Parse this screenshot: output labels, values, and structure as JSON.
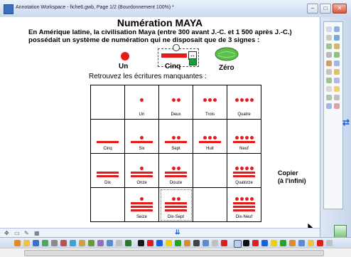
{
  "window": {
    "title": "Annotation Workspace - fiche6.gwb, Page 1/2  (Bourdonnement 100%) *"
  },
  "page": {
    "title": "Numération MAYA",
    "intro": "En Amérique latine, la civilisation Maya (entre 300 avant J.-C. et 1 500 après J.-C.) possédait un système de numération qui ne disposait que de 3 signes :",
    "signs": [
      "Un",
      "Cinq",
      "Zéro"
    ],
    "subtitle": "Retrouvez les écritures manquantes :",
    "copy_note": [
      "Copier",
      "(à l'infini)"
    ]
  },
  "grid": {
    "rows": [
      [
        {
          "label": "",
          "value": null
        },
        {
          "label": "Un",
          "value": 1
        },
        {
          "label": "Deux",
          "value": 2
        },
        {
          "label": "Trois",
          "value": 3
        },
        {
          "label": "Quatre",
          "value": 4
        }
      ],
      [
        {
          "label": "Cinq",
          "value": 5
        },
        {
          "label": "Six",
          "value": 6
        },
        {
          "label": "Sept",
          "value": 7
        },
        {
          "label": "Huit",
          "value": 8
        },
        {
          "label": "Neuf",
          "value": 9
        }
      ],
      [
        {
          "label": "Dix",
          "value": 10
        },
        {
          "label": "Onze",
          "value": 11
        },
        {
          "label": "Douze",
          "value": 12
        },
        {
          "label": "",
          "value": null
        },
        {
          "label": "Quatorze",
          "value": 14
        }
      ],
      [
        {
          "label": "",
          "value": null
        },
        {
          "label": "Seize",
          "value": 16
        },
        {
          "label": "Dix-Sept",
          "value": 17
        },
        {
          "label": "",
          "value": null
        },
        {
          "label": "Dix-Neuf",
          "value": 19
        }
      ]
    ]
  },
  "colors": {
    "glyph": "#e31b1b",
    "accent": "#1b5fd6",
    "shell": "#5cbf4a"
  }
}
